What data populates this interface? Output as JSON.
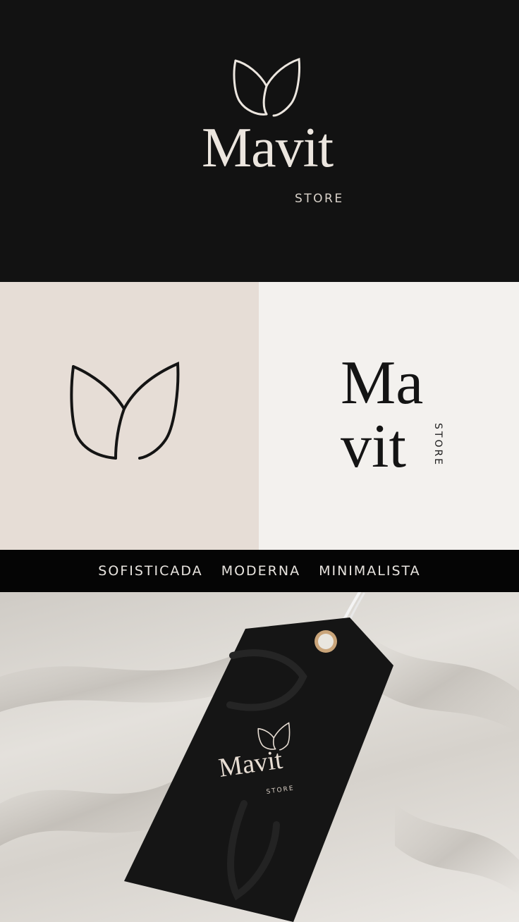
{
  "brand": {
    "name": "Mavit",
    "name_line1": "Ma",
    "name_line2": "vit",
    "tagline": "STORE"
  },
  "values": [
    "SOFISTICADA",
    "MODERNA",
    "MINIMALISTA"
  ],
  "colors": {
    "dark": "#121212",
    "beige": "#e6ddd6",
    "offwhite": "#f3f1ee",
    "strip": "#050505",
    "cream_text": "#ece6df"
  },
  "icons": {
    "logo": "leaf-m-icon"
  }
}
